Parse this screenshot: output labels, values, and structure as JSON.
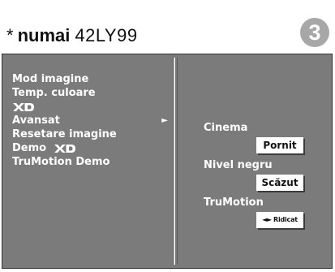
{
  "header": {
    "star": "*",
    "brand": "numai",
    "model": "42LY99",
    "page_number": "3"
  },
  "menu": {
    "items": [
      {
        "label": "Mod imagine",
        "logo": null,
        "selected": false
      },
      {
        "label": "Temp. culoare",
        "logo": null,
        "selected": false
      },
      {
        "label": "",
        "logo": "XD",
        "selected": false
      },
      {
        "label": "Avansat",
        "logo": null,
        "selected": true,
        "arrow": "►"
      },
      {
        "label": "Resetare imagine",
        "logo": null,
        "selected": false
      },
      {
        "label": "Demo",
        "logo": "XD",
        "selected": false
      },
      {
        "label": "TruMotion Demo",
        "logo": null,
        "selected": false
      }
    ]
  },
  "settings": [
    {
      "label": "Cinema",
      "value": "Pornit",
      "arrows": null
    },
    {
      "label": "Nivel negru",
      "value": "Scăzut",
      "arrows": null
    },
    {
      "label": "TruMotion",
      "value": "Ridicat",
      "arrows": "◄►"
    }
  ],
  "colors": {
    "osd_background": "#7b7b7b",
    "badge": "#a7a7a7",
    "text_light": "#ffffff",
    "divider": "#e5e5e5"
  },
  "icons": {
    "xd_logo": "xd-logo-icon",
    "submenu_arrow": "right-triangle-icon",
    "left_right_arrows": "left-right-arrows-icon"
  }
}
